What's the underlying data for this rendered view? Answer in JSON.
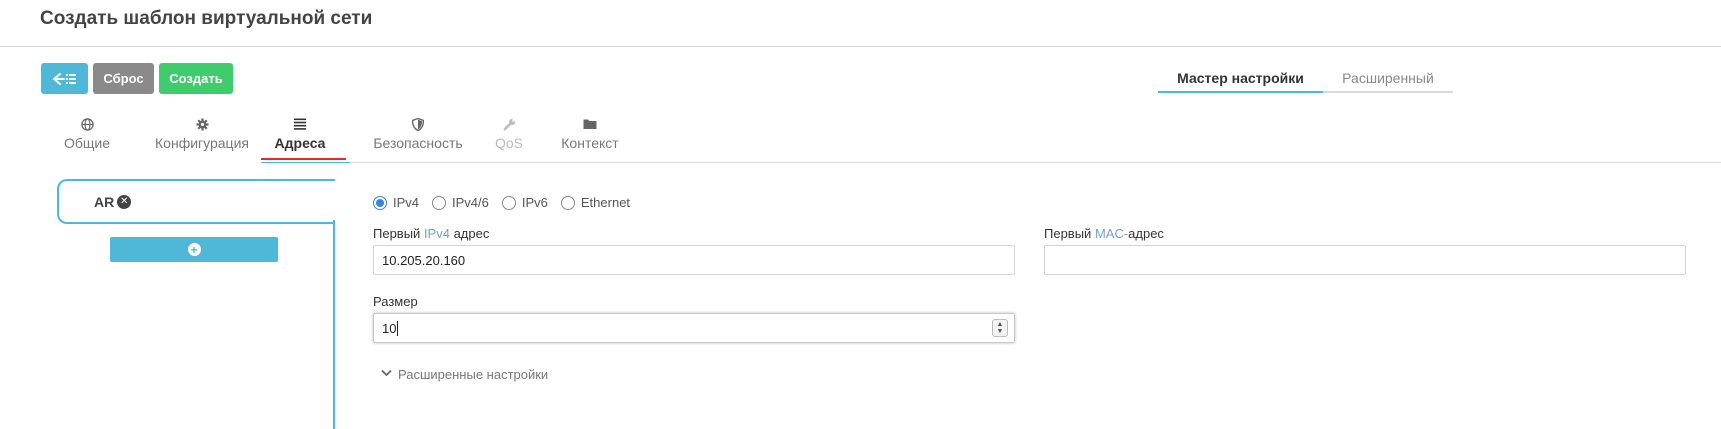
{
  "page": {
    "title": "Создать шаблон виртуальной сети"
  },
  "toolbar": {
    "back_icon": "arrow-left-list-icon",
    "reset_label": "Сброс",
    "create_label": "Создать"
  },
  "mode_tabs": [
    {
      "label": "Мастер настройки",
      "active": true
    },
    {
      "label": "Расширенный",
      "active": false
    }
  ],
  "section_tabs": [
    {
      "label": "Общие",
      "icon": "globe-icon",
      "glyph": "🌐"
    },
    {
      "label": "Конфигурация",
      "icon": "cog-icon",
      "glyph": "⚙"
    },
    {
      "label": "Адреса",
      "icon": "list-icon",
      "glyph": "≣",
      "active": true
    },
    {
      "label": "Безопасность",
      "icon": "shield-icon",
      "glyph": "◈"
    },
    {
      "label": "QoS",
      "icon": "wrench-icon",
      "glyph": "🔧",
      "disabled": true
    },
    {
      "label": "Контекст",
      "icon": "folder-icon",
      "glyph": "▬"
    }
  ],
  "ranges": [
    {
      "label": "AR"
    }
  ],
  "address_type": {
    "options": [
      "IPv4",
      "IPv4/6",
      "IPv6",
      "Ethernet"
    ],
    "selected": "IPv4"
  },
  "form": {
    "ipv4_label_prefix": "Первый ",
    "ipv4_label_hl": "IPv4",
    "ipv4_label_suffix": " адрес",
    "ipv4_value": "10.205.20.160",
    "mac_label_prefix": "Первый ",
    "mac_label_hl": "MAC-",
    "mac_label_suffix": "адрес",
    "mac_value": "",
    "size_label": "Размер",
    "size_value": "10",
    "advanced_label": "Расширенные настройки"
  },
  "colors": {
    "accent": "#4fb8d9",
    "reset": "#8a8a8a",
    "create": "#3fcc6e",
    "active_tab_underline": "#e02b2b",
    "radio_checked": "#3b82e0"
  }
}
